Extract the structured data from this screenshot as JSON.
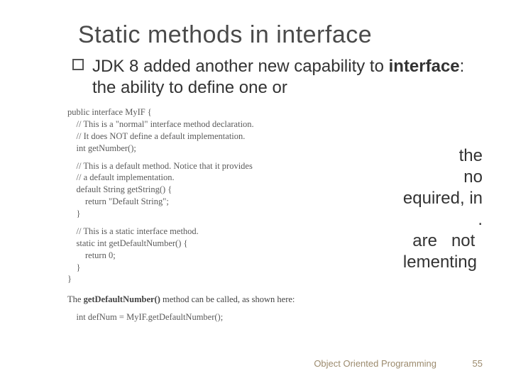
{
  "title": "Static methods in interface",
  "bullet1_prefix": "JDK 8 added another new capability to ",
  "bullet1_kw": "interface",
  "bullet1_suffix": ": the ability to define one or",
  "fragments": {
    "l1": "the",
    "l2": "no",
    "l3": "equired, in",
    "l4": ".",
    "l5a": "  are   not",
    "l5b": "lementing"
  },
  "code": {
    "l01": "public interface MyIF {",
    "l02": "    // This is a \"normal\" interface method declaration.",
    "l03": "    // It does NOT define a default implementation.",
    "l04": "    int getNumber();",
    "l05": "    // This is a default method. Notice that it provides",
    "l06": "    // a default implementation.",
    "l07": "    default String getString() {",
    "l08": "        return \"Default String\";",
    "l09": "    }",
    "l10": "    // This is a static interface method.",
    "l11": "    static int getDefaultNumber() {",
    "l12": "        return 0;",
    "l13": "    }",
    "l14": "}"
  },
  "caption_prefix": "The ",
  "caption_bold": "getDefaultNumber()",
  "caption_suffix": " method can be called, as shown here:",
  "caption_code": "    int defNum = MyIF.getDefaultNumber();",
  "footer": "Object Oriented Programming",
  "slide_number": "55"
}
